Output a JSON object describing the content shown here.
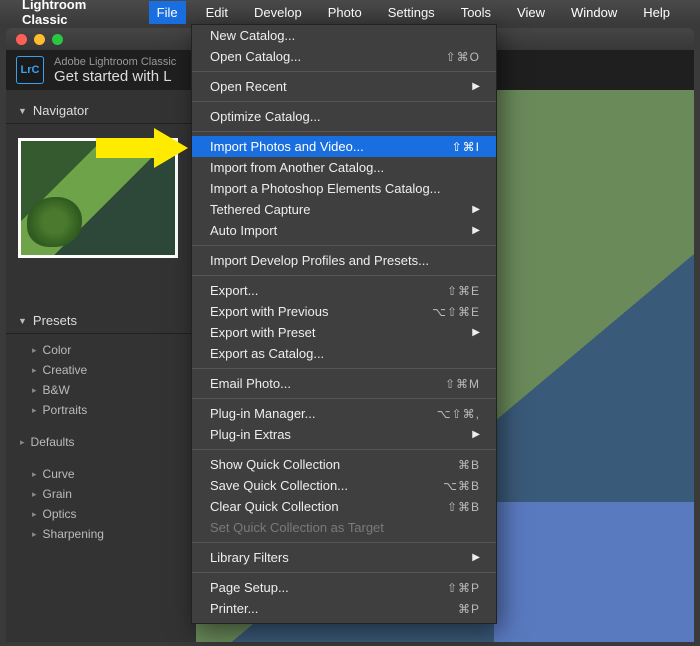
{
  "menubar": {
    "app_name": "Lightroom Classic",
    "items": [
      "File",
      "Edit",
      "Develop",
      "Photo",
      "Settings",
      "Tools",
      "View",
      "Window",
      "Help"
    ],
    "active_index": 0
  },
  "window": {
    "header_small": "Adobe Lightroom Classic",
    "header_title": "Get started with L"
  },
  "sidebar": {
    "navigator_label": "Navigator",
    "presets_label": "Presets",
    "preset_groups": [
      "Color",
      "Creative",
      "B&W",
      "Portraits"
    ],
    "defaults_label": "Defaults",
    "extra_groups": [
      "Curve",
      "Grain",
      "Optics",
      "Sharpening"
    ]
  },
  "menu": {
    "groups": [
      [
        {
          "label": "New Catalog...",
          "shortcut": "",
          "submenu": false
        },
        {
          "label": "Open Catalog...",
          "shortcut": "⇧⌘O",
          "submenu": false
        }
      ],
      [
        {
          "label": "Open Recent",
          "shortcut": "",
          "submenu": true
        }
      ],
      [
        {
          "label": "Optimize Catalog...",
          "shortcut": "",
          "submenu": false
        }
      ],
      [
        {
          "label": "Import Photos and Video...",
          "shortcut": "⇧⌘I",
          "submenu": false,
          "selected": true
        },
        {
          "label": "Import from Another Catalog...",
          "shortcut": "",
          "submenu": false
        },
        {
          "label": "Import a Photoshop Elements Catalog...",
          "shortcut": "",
          "submenu": false
        },
        {
          "label": "Tethered Capture",
          "shortcut": "",
          "submenu": true
        },
        {
          "label": "Auto Import",
          "shortcut": "",
          "submenu": true
        }
      ],
      [
        {
          "label": "Import Develop Profiles and Presets...",
          "shortcut": "",
          "submenu": false
        }
      ],
      [
        {
          "label": "Export...",
          "shortcut": "⇧⌘E",
          "submenu": false
        },
        {
          "label": "Export with Previous",
          "shortcut": "⌥⇧⌘E",
          "submenu": false
        },
        {
          "label": "Export with Preset",
          "shortcut": "",
          "submenu": true
        },
        {
          "label": "Export as Catalog...",
          "shortcut": "",
          "submenu": false
        }
      ],
      [
        {
          "label": "Email Photo...",
          "shortcut": "⇧⌘M",
          "submenu": false
        }
      ],
      [
        {
          "label": "Plug-in Manager...",
          "shortcut": "⌥⇧⌘,",
          "submenu": false
        },
        {
          "label": "Plug-in Extras",
          "shortcut": "",
          "submenu": true
        }
      ],
      [
        {
          "label": "Show Quick Collection",
          "shortcut": "⌘B",
          "submenu": false
        },
        {
          "label": "Save Quick Collection...",
          "shortcut": "⌥⌘B",
          "submenu": false
        },
        {
          "label": "Clear Quick Collection",
          "shortcut": "⇧⌘B",
          "submenu": false
        },
        {
          "label": "Set Quick Collection as Target",
          "shortcut": "",
          "submenu": false,
          "disabled": true
        }
      ],
      [
        {
          "label": "Library Filters",
          "shortcut": "",
          "submenu": true
        }
      ],
      [
        {
          "label": "Page Setup...",
          "shortcut": "⇧⌘P",
          "submenu": false
        },
        {
          "label": "Printer...",
          "shortcut": "⌘P",
          "submenu": false
        }
      ]
    ]
  }
}
